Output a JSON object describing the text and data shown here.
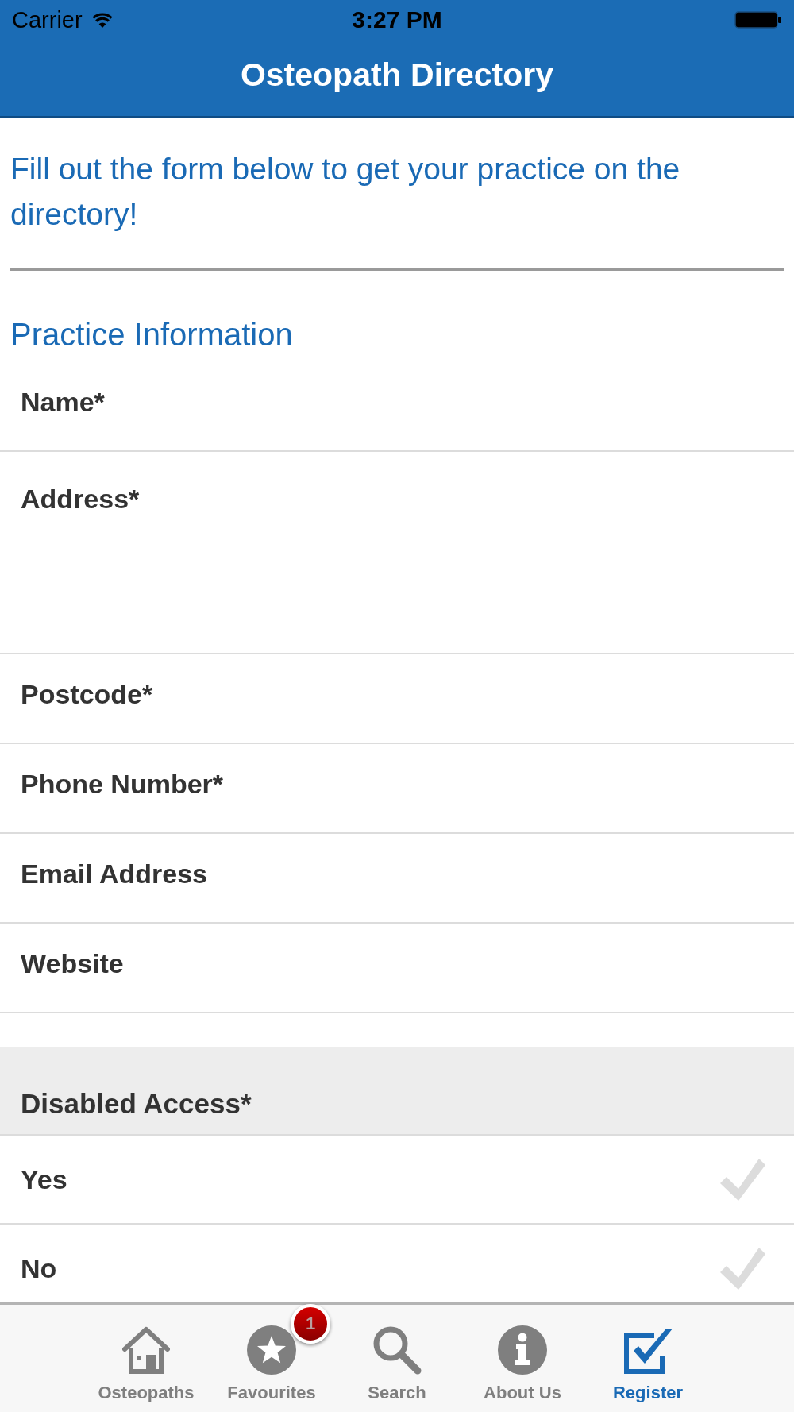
{
  "status_bar": {
    "carrier": "Carrier",
    "time": "3:27 PM"
  },
  "nav_bar": {
    "title": "Osteopath Directory"
  },
  "intro": "Fill out the form below to get your practice on the directory!",
  "practice_information": {
    "title": "Practice Information",
    "fields": [
      {
        "kind": "text",
        "placeholder": "Name*"
      },
      {
        "kind": "textarea",
        "placeholder": "Address*"
      },
      {
        "kind": "text",
        "placeholder": "Postcode*"
      },
      {
        "kind": "text",
        "placeholder": "Phone Number*"
      },
      {
        "kind": "text",
        "placeholder": "Email Address"
      },
      {
        "kind": "text",
        "placeholder": "Website"
      }
    ]
  },
  "disabled_access": {
    "title": "Disabled Access*",
    "options": [
      {
        "label": "Yes",
        "selected": false
      },
      {
        "label": "No",
        "selected": false
      }
    ]
  },
  "tab_bar": {
    "tabs": [
      {
        "label": "Osteopaths",
        "selected": false
      },
      {
        "label": "Favourites",
        "selected": false,
        "badge": "1"
      },
      {
        "label": "Search",
        "selected": false
      },
      {
        "label": "About Us",
        "selected": false
      },
      {
        "label": "Register",
        "selected": true
      }
    ]
  }
}
